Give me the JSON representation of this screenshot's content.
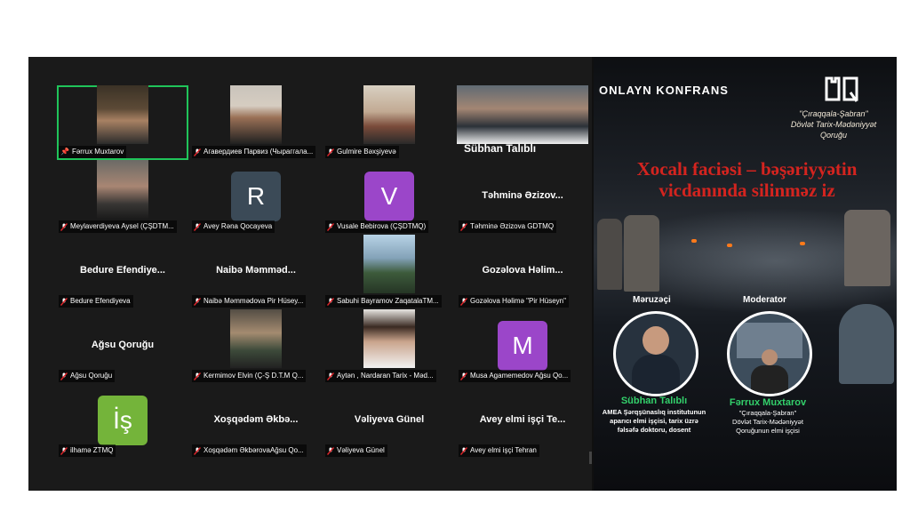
{
  "participants": [
    {
      "name": "Fərrux Muxtarov",
      "pinned": true,
      "active": true
    },
    {
      "name": "Агавердиев Парвиз (Чыраггала..."
    },
    {
      "name": "Gulmire Bəxşiyevə"
    },
    {
      "name": "Sübhan Talıblı"
    },
    {
      "name": "Meylaverdiyeva Aysel (ÇŞDTM..."
    },
    {
      "name": "Avey Rəna Qocayeva",
      "initial": "R",
      "color": "#3b4a57"
    },
    {
      "name": "Vusale Bebirova (ÇŞDTMQ)",
      "initial": "V",
      "color": "#9b46c9"
    },
    {
      "name": "Təhminə Əzizova GDTMQ",
      "display": "Təhminə Əzizov..."
    },
    {
      "name": "Bedure Efendiyeva",
      "display": "Bedure Efendiye..."
    },
    {
      "name": "Naibə Məmmədova Pir Hüsey...",
      "display": "Naibə Məmməd..."
    },
    {
      "name": "Sabuhi Bayramov ZaqatalaTM..."
    },
    {
      "name": "Gozəlova Həlimə \"Pir Hüseyn\"",
      "display": "Gozəlova Həlim..."
    },
    {
      "name": "Ağsu Qoruğu",
      "display": "Ağsu Qoruğu"
    },
    {
      "name": "Kermimov Elvin (Ç-Ş D.T.M Q..."
    },
    {
      "name": "Aytən , Nardaran Tarix - Məd..."
    },
    {
      "name": "Musa Agamemedov Ağsu Qo...",
      "initial": "M",
      "color": "#9b46c9"
    },
    {
      "name": "ilhamə ZTMQ",
      "initial": "İş",
      "color": "#74b43a"
    },
    {
      "name": "Xoşqədəm ƏkbərovaAğsu Qo...",
      "display": "Xoşqədəm Əkbə..."
    },
    {
      "name": "Vəliyeva Günel",
      "display": "Vəliyeva Günel"
    },
    {
      "name": "Avey elmi işçi Tehran",
      "display": "Avey elmi işçi Te..."
    }
  ],
  "poster": {
    "conference": "ONLAYN KONFRANS",
    "org_line1": "\"Çıraqqala-Şabran\"",
    "org_line2": "Dövlət Tarix-Mədəniyyət",
    "org_line3": "Qoruğu",
    "title_line1": "Xocalı faciəsi – bəşəriyyətin",
    "title_line2": "vicdanında silinməz iz",
    "speaker_heading": "Məruzəçi",
    "moderator_heading": "Moderator",
    "speaker_name": "Sübhan Talıblı",
    "speaker_desc1": "AMEA Şərqşünaslıq institutunun",
    "speaker_desc2": "aparıcı elmi işçisi, tarix üzrə",
    "speaker_desc3": "fəlsəfə doktoru, dosent",
    "moderator_name": "Fərrux Muxtarov",
    "moderator_desc1": "\"Çıraqqala-Şabran\"",
    "moderator_desc2": "Dövlət Tarix-Mədəniyyət",
    "moderator_desc3": "Qoruğunun elmi işçisi"
  },
  "colors": {
    "active_border": "#20c45a",
    "title_red": "#d4241f",
    "name_green": "#33d06b",
    "muted_mic": "#e0242a"
  }
}
